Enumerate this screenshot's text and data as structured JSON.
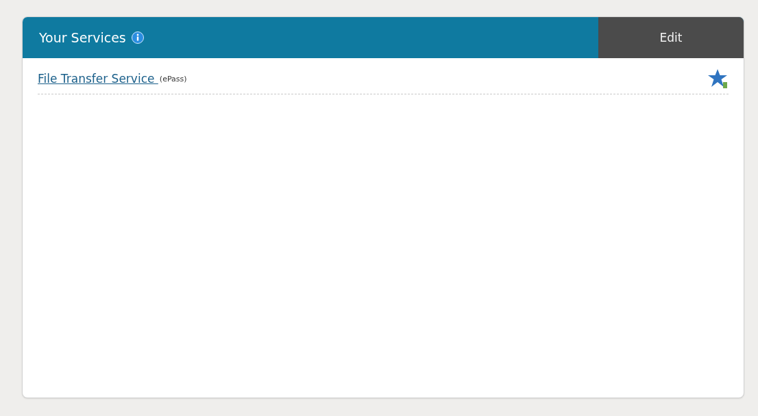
{
  "panel": {
    "title": "Your Services",
    "edit_button": "Edit"
  },
  "services": [
    {
      "name": "File Transfer Service ",
      "note": "(ePass)"
    }
  ]
}
